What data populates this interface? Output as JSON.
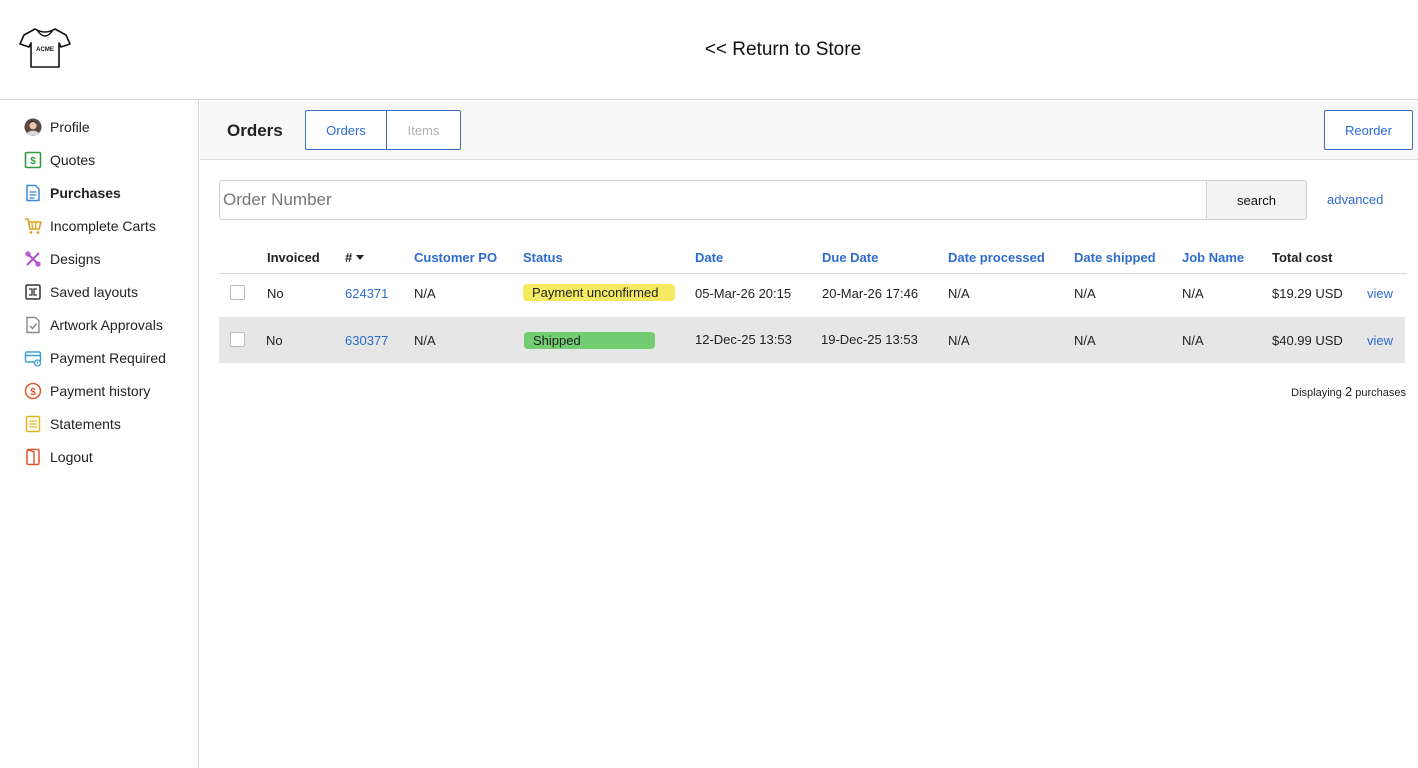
{
  "header": {
    "return_link": "<< Return to Store",
    "logo_text": "ACME"
  },
  "sidebar": {
    "items": [
      {
        "label": "Profile",
        "icon": "avatar-icon"
      },
      {
        "label": "Quotes",
        "icon": "dollar-icon"
      },
      {
        "label": "Purchases",
        "icon": "document-icon",
        "active": true
      },
      {
        "label": "Incomplete Carts",
        "icon": "cart-icon"
      },
      {
        "label": "Designs",
        "icon": "design-tools-icon"
      },
      {
        "label": "Saved layouts",
        "icon": "layout-icon"
      },
      {
        "label": "Artwork Approvals",
        "icon": "approval-icon"
      },
      {
        "label": "Payment Required",
        "icon": "payment-card-icon"
      },
      {
        "label": "Payment history",
        "icon": "history-coin-icon"
      },
      {
        "label": "Statements",
        "icon": "statement-icon"
      },
      {
        "label": "Logout",
        "icon": "logout-icon"
      }
    ]
  },
  "toolbar": {
    "title": "Orders",
    "tabs": [
      {
        "label": "Orders",
        "active": true
      },
      {
        "label": "Items",
        "active": false
      }
    ],
    "reorder_label": "Reorder"
  },
  "search": {
    "placeholder": "Order Number",
    "value": "",
    "button_label": "search",
    "advanced_label": "advanced"
  },
  "table": {
    "columns": {
      "invoiced": "Invoiced",
      "number": "#",
      "customer_po": "Customer PO",
      "status": "Status",
      "date": "Date",
      "due_date": "Due Date",
      "date_processed": "Date processed",
      "date_shipped": "Date shipped",
      "job_name": "Job Name",
      "total_cost": "Total cost"
    },
    "rows": [
      {
        "invoiced": "No",
        "number": "624371",
        "customer_po": "N/A",
        "status": "Payment unconfirmed",
        "status_color": "#f5ea62",
        "date": "05-Mar-26 20:15",
        "due_date": "20-Mar-26 17:46",
        "date_processed": "N/A",
        "date_shipped": "N/A",
        "job_name": "N/A",
        "total_cost": "$19.29 USD",
        "action": "view"
      },
      {
        "invoiced": "No",
        "number": "630377",
        "customer_po": "N/A",
        "status": "Shipped",
        "status_color": "#72cd72",
        "date": "12-Dec-25 13:53",
        "due_date": "19-Dec-25 13:53",
        "date_processed": "N/A",
        "date_shipped": "N/A",
        "job_name": "N/A",
        "total_cost": "$40.99 USD",
        "action": "view"
      }
    ],
    "footer_prefix": "Displaying",
    "footer_count": "2",
    "footer_suffix": "purchases"
  },
  "colors": {
    "accent": "#2d6bd0",
    "status_yellow": "#f5ea62",
    "status_green": "#72cd72"
  }
}
